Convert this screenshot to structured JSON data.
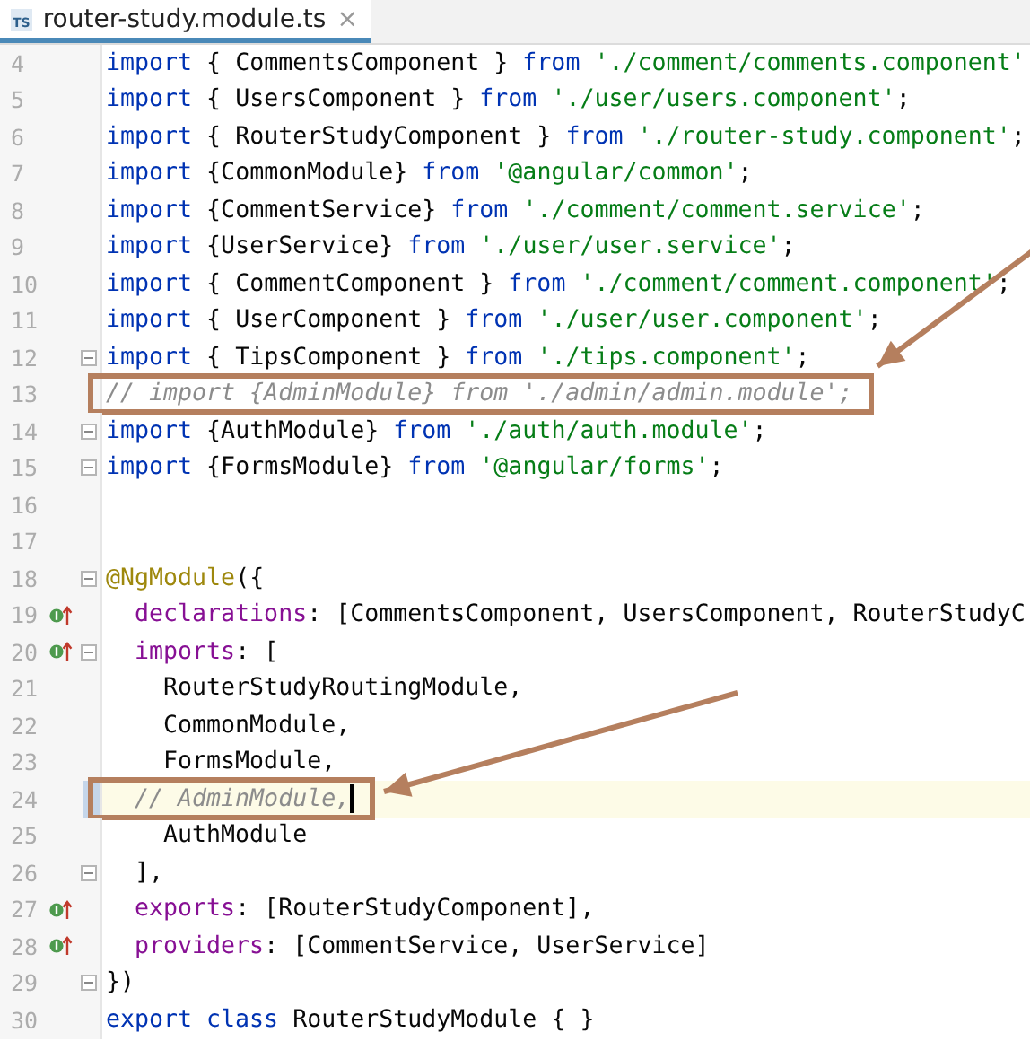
{
  "tab": {
    "label": "router-study.module.ts",
    "icon": "TS",
    "close": "×",
    "selected": true
  },
  "lines": [
    {
      "number": "4",
      "tokens": [
        {
          "kind": "kw",
          "text": "import"
        },
        {
          "kind": "plain",
          "text": " { CommentsComponent } "
        },
        {
          "kind": "kw",
          "text": "from "
        },
        {
          "kind": "str",
          "text": "'./comment/comments.component'"
        }
      ]
    },
    {
      "number": "5",
      "tokens": [
        {
          "kind": "kw",
          "text": "import"
        },
        {
          "kind": "plain",
          "text": " { UsersComponent } "
        },
        {
          "kind": "kw",
          "text": "from "
        },
        {
          "kind": "str",
          "text": "'./user/users.component'"
        },
        {
          "kind": "plain",
          "text": ";"
        }
      ]
    },
    {
      "number": "6",
      "tokens": [
        {
          "kind": "kw",
          "text": "import"
        },
        {
          "kind": "plain",
          "text": " { RouterStudyComponent } "
        },
        {
          "kind": "kw",
          "text": "from "
        },
        {
          "kind": "str",
          "text": "'./router-study.component'"
        },
        {
          "kind": "plain",
          "text": ";"
        }
      ]
    },
    {
      "number": "7",
      "tokens": [
        {
          "kind": "kw",
          "text": "import"
        },
        {
          "kind": "plain",
          "text": " {CommonModule} "
        },
        {
          "kind": "kw",
          "text": "from "
        },
        {
          "kind": "str",
          "text": "'@angular/common'"
        },
        {
          "kind": "plain",
          "text": ";"
        }
      ]
    },
    {
      "number": "8",
      "tokens": [
        {
          "kind": "kw",
          "text": "import"
        },
        {
          "kind": "plain",
          "text": " {CommentService} "
        },
        {
          "kind": "kw",
          "text": "from "
        },
        {
          "kind": "str",
          "text": "'./comment/comment.service'"
        },
        {
          "kind": "plain",
          "text": ";"
        }
      ]
    },
    {
      "number": "9",
      "tokens": [
        {
          "kind": "kw",
          "text": "import"
        },
        {
          "kind": "plain",
          "text": " {UserService} "
        },
        {
          "kind": "kw",
          "text": "from "
        },
        {
          "kind": "str",
          "text": "'./user/user.service'"
        },
        {
          "kind": "plain",
          "text": ";"
        }
      ]
    },
    {
      "number": "10",
      "tokens": [
        {
          "kind": "kw",
          "text": "import"
        },
        {
          "kind": "plain",
          "text": " { CommentComponent } "
        },
        {
          "kind": "kw",
          "text": "from "
        },
        {
          "kind": "str",
          "text": "'./comment/comment.component'"
        },
        {
          "kind": "plain",
          "text": ";"
        }
      ]
    },
    {
      "number": "11",
      "tokens": [
        {
          "kind": "kw",
          "text": "import"
        },
        {
          "kind": "plain",
          "text": " { UserComponent } "
        },
        {
          "kind": "kw",
          "text": "from "
        },
        {
          "kind": "str",
          "text": "'./user/user.component'"
        },
        {
          "kind": "plain",
          "text": ";"
        }
      ]
    },
    {
      "number": "12",
      "fold": true,
      "tokens": [
        {
          "kind": "kw",
          "text": "import"
        },
        {
          "kind": "plain",
          "text": " { TipsComponent } "
        },
        {
          "kind": "kw",
          "text": "from "
        },
        {
          "kind": "str",
          "text": "'./tips.component'"
        },
        {
          "kind": "plain",
          "text": ";"
        }
      ]
    },
    {
      "number": "13",
      "highlighted": true,
      "tokens": [
        {
          "kind": "com",
          "text": "// import {AdminModule} from './admin/admin.module';"
        }
      ]
    },
    {
      "number": "14",
      "fold": true,
      "tokens": [
        {
          "kind": "kw",
          "text": "import"
        },
        {
          "kind": "plain",
          "text": " {AuthModule} "
        },
        {
          "kind": "kw",
          "text": "from "
        },
        {
          "kind": "str",
          "text": "'./auth/auth.module'"
        },
        {
          "kind": "plain",
          "text": ";"
        }
      ]
    },
    {
      "number": "15",
      "fold": true,
      "tokens": [
        {
          "kind": "kw",
          "text": "import"
        },
        {
          "kind": "plain",
          "text": " {FormsModule} "
        },
        {
          "kind": "kw",
          "text": "from "
        },
        {
          "kind": "str",
          "text": "'@angular/forms'"
        },
        {
          "kind": "plain",
          "text": ";"
        }
      ]
    },
    {
      "number": "16"
    },
    {
      "number": "17"
    },
    {
      "number": "18",
      "fold": true,
      "tokens": [
        {
          "kind": "deco",
          "text": "@NgModule"
        },
        {
          "kind": "plain",
          "text": "({"
        }
      ]
    },
    {
      "number": "19",
      "marker": true,
      "tokens": [
        {
          "kind": "prop",
          "text": "  declarations"
        },
        {
          "kind": "plain",
          "text": ": [CommentsComponent, UsersComponent, RouterStudyC"
        }
      ]
    },
    {
      "number": "20",
      "marker": true,
      "fold": true,
      "tokens": [
        {
          "kind": "prop",
          "text": "  imports"
        },
        {
          "kind": "plain",
          "text": ": ["
        }
      ]
    },
    {
      "number": "21",
      "tokens": [
        {
          "kind": "plain",
          "text": "    RouterStudyRoutingModule,"
        }
      ]
    },
    {
      "number": "22",
      "tokens": [
        {
          "kind": "plain",
          "text": "    CommonModule,"
        }
      ]
    },
    {
      "number": "23",
      "tokens": [
        {
          "kind": "plain",
          "text": "    FormsModule,"
        }
      ]
    },
    {
      "number": "24",
      "highlighted": true,
      "current": true,
      "tokens": [
        {
          "kind": "com",
          "text": "  // AdminModule,"
        }
      ]
    },
    {
      "number": "25",
      "tokens": [
        {
          "kind": "plain",
          "text": "    AuthModule"
        }
      ]
    },
    {
      "number": "26",
      "fold": true,
      "tokens": [
        {
          "kind": "plain",
          "text": "  ],"
        }
      ]
    },
    {
      "number": "27",
      "marker": true,
      "tokens": [
        {
          "kind": "prop",
          "text": "  exports"
        },
        {
          "kind": "plain",
          "text": ": [RouterStudyComponent],"
        }
      ]
    },
    {
      "number": "28",
      "marker": true,
      "tokens": [
        {
          "kind": "prop",
          "text": "  providers"
        },
        {
          "kind": "plain",
          "text": ": [CommentService, UserService]"
        }
      ]
    },
    {
      "number": "29",
      "fold": true,
      "tokens": [
        {
          "kind": "plain",
          "text": "})"
        }
      ]
    },
    {
      "number": "30",
      "tokens": [
        {
          "kind": "kw",
          "text": "export class"
        },
        {
          "kind": "plain",
          "text": " RouterStudyModule { }"
        }
      ]
    }
  ]
}
